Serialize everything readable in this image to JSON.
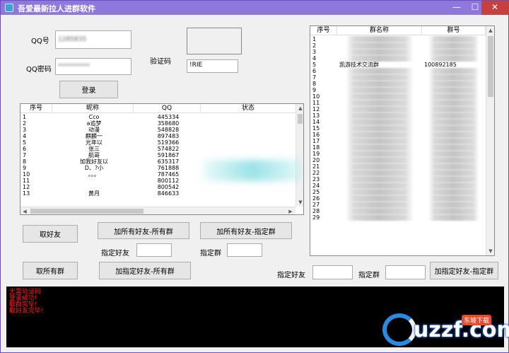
{
  "window": {
    "title": "吾爱最新拉人进群软件"
  },
  "login": {
    "qq_label": "QQ号",
    "qq_value": "1285835",
    "password_label": "QQ密码",
    "password_value": "**********",
    "captcha_label": "验证码",
    "captcha_value": "!RIE",
    "login_button": "登录"
  },
  "friends": {
    "headers": [
      "序号",
      "昵称",
      "QQ",
      "状态"
    ],
    "rows": [
      [
        "1",
        "Cco",
        "445334",
        ""
      ],
      [
        "2",
        "a追梦",
        "358680",
        ""
      ],
      [
        "3",
        "动漫",
        "548828",
        ""
      ],
      [
        "4",
        "麒麟一",
        "897483",
        ""
      ],
      [
        "5",
        "光年以",
        "519366",
        ""
      ],
      [
        "6",
        "张三",
        "574822",
        ""
      ],
      [
        "7",
        "航哥",
        "591867",
        ""
      ],
      [
        "8",
        "加我好友以",
        "635317",
        ""
      ],
      [
        "9",
        "D、?小",
        "761888",
        ""
      ],
      [
        "10",
        "。。。",
        "787465",
        ""
      ],
      [
        "11",
        "",
        "800112",
        ""
      ],
      [
        "12",
        "",
        "800542",
        ""
      ],
      [
        "13",
        "黄月",
        "846633",
        ""
      ]
    ]
  },
  "groups": {
    "headers": [
      "序号",
      "群名称",
      "群号"
    ],
    "rows": [
      [
        "1",
        "",
        ""
      ],
      [
        "2",
        "",
        ""
      ],
      [
        "3",
        "",
        ""
      ],
      [
        "4",
        "",
        ""
      ],
      [
        "5",
        "凯游技术交流群",
        "100892185"
      ],
      [
        "6",
        "",
        ""
      ],
      [
        "7",
        "",
        ""
      ],
      [
        "8",
        "",
        ""
      ],
      [
        "9",
        "",
        ""
      ],
      [
        "10",
        "",
        ""
      ],
      [
        "11",
        "",
        ""
      ],
      [
        "12",
        "",
        ""
      ],
      [
        "13",
        "",
        ""
      ],
      [
        "14",
        "",
        ""
      ],
      [
        "15",
        "",
        ""
      ],
      [
        "16",
        "",
        ""
      ],
      [
        "17",
        "",
        ""
      ],
      [
        "18",
        "",
        ""
      ],
      [
        "19",
        "",
        ""
      ],
      [
        "20",
        "",
        ""
      ],
      [
        "21",
        "",
        ""
      ],
      [
        "22",
        "",
        ""
      ],
      [
        "23",
        "",
        ""
      ],
      [
        "24",
        "",
        ""
      ],
      [
        "25",
        "",
        ""
      ],
      [
        "26",
        "",
        ""
      ],
      [
        "27",
        "",
        ""
      ],
      [
        "28",
        "",
        ""
      ],
      [
        "29",
        "",
        ""
      ]
    ]
  },
  "actions": {
    "get_friends": "取好友",
    "add_all_friends_all_groups": "加所有好友-所有群",
    "add_all_friends_specific_group": "加所有好友-指定群",
    "specified_friend_label": "指定好友",
    "specified_group_label": "指定群",
    "get_all_groups": "取所有群",
    "add_specific_friend_all_groups": "加指定好友-所有群",
    "specified_friend_label_2": "指定好友",
    "specified_group_label_2": "指定群",
    "add_specific_friend_specific_group": "加指定好友-指定群"
  },
  "console": {
    "lines": [
      "无需验证码",
      "登录成功!",
      "取群完毕!",
      "取好友完毕!"
    ]
  },
  "watermark": {
    "text": "uzzf.com",
    "sub": "东坡下载"
  },
  "colors": {
    "titlebar": "#8f78dc",
    "console_bg": "#000000",
    "console_text": "#ff2020"
  }
}
